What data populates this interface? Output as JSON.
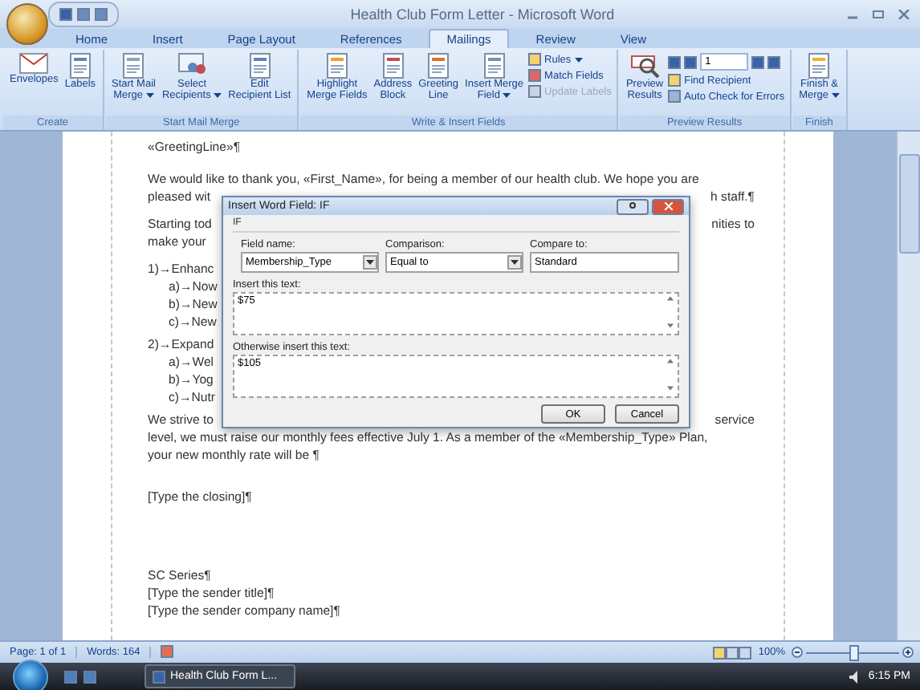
{
  "window": {
    "title": "Health Club Form Letter - Microsoft Word"
  },
  "tabs": [
    {
      "label": "Home",
      "selected": false
    },
    {
      "label": "Insert",
      "selected": false
    },
    {
      "label": "Page Layout",
      "selected": false
    },
    {
      "label": "References",
      "selected": false
    },
    {
      "label": "Mailings",
      "selected": true
    },
    {
      "label": "Review",
      "selected": false
    },
    {
      "label": "View",
      "selected": false
    }
  ],
  "ribbon": [
    {
      "label": "Create",
      "items": [
        {
          "kind": "large",
          "lines": [
            "Envelopes"
          ],
          "dropdown": false
        },
        {
          "kind": "large",
          "lines": [
            "Labels"
          ],
          "dropdown": false
        }
      ]
    },
    {
      "label": "Start Mail Merge",
      "items": [
        {
          "kind": "large",
          "lines": [
            "Start Mail",
            "Merge"
          ],
          "dropdown": true
        },
        {
          "kind": "large",
          "lines": [
            "Select",
            "Recipients"
          ],
          "dropdown": true
        },
        {
          "kind": "large",
          "lines": [
            "Edit",
            "Recipient List"
          ],
          "dropdown": false
        }
      ]
    },
    {
      "label": "Write & Insert Fields",
      "items": [
        {
          "kind": "large",
          "lines": [
            "Highlight",
            "Merge Fields"
          ],
          "dropdown": false
        },
        {
          "kind": "large",
          "lines": [
            "Address",
            "Block"
          ],
          "dropdown": false
        },
        {
          "kind": "large",
          "lines": [
            "Greeting",
            "Line"
          ],
          "dropdown": false
        },
        {
          "kind": "large",
          "lines": [
            "Insert Merge",
            "Field"
          ],
          "dropdown": true
        },
        {
          "kind": "stack",
          "rows": [
            {
              "label": "Rules",
              "dropdown": true,
              "disabled": false
            },
            {
              "label": "Match Fields",
              "dropdown": false,
              "disabled": false
            },
            {
              "label": "Update Labels",
              "dropdown": false,
              "disabled": true
            }
          ]
        }
      ]
    },
    {
      "label": "Preview Results",
      "items": [
        {
          "kind": "large",
          "lines": [
            "Preview",
            "Results"
          ],
          "dropdown": false
        },
        {
          "kind": "nav",
          "value": "1",
          "rows": [
            {
              "label": "Find Recipient",
              "dropdown": false,
              "disabled": false
            },
            {
              "label": "Auto Check for Errors",
              "dropdown": false,
              "disabled": false
            }
          ]
        }
      ]
    },
    {
      "label": "Finish",
      "items": [
        {
          "kind": "large",
          "lines": [
            "Finish &",
            "Merge"
          ],
          "dropdown": true
        }
      ]
    }
  ],
  "document": {
    "paragraphs": [
      {
        "kind": "greeting",
        "lines": [
          {
            "kind": "text",
            "left": "«GreetingLine»¶"
          }
        ]
      },
      {
        "kind": "body",
        "lines": [
          {
            "kind": "text",
            "left": "We would like to thank you, «First_Name», for being a member of our health club. We hope you are"
          },
          {
            "kind": "text",
            "left": "pleased wit",
            "right": "h staff.¶"
          }
        ]
      },
      {
        "kind": "body",
        "lines": [
          {
            "kind": "text",
            "left": "Starting tod",
            "right": "nities to"
          },
          {
            "kind": "text",
            "left": "make your"
          }
        ]
      },
      {
        "kind": "list",
        "lines": [
          {
            "kind": "item",
            "left": "1)→Enhanc"
          },
          {
            "kind": "subitem",
            "left": "a)→Now"
          },
          {
            "kind": "subitem",
            "left": "b)→New"
          },
          {
            "kind": "subitem",
            "left": "c)→New"
          }
        ]
      },
      {
        "kind": "list",
        "lines": [
          {
            "kind": "item",
            "left": "2)→Expand"
          },
          {
            "kind": "subitem",
            "left": "a)→Wel"
          },
          {
            "kind": "subitem",
            "left": "b)→Yog"
          },
          {
            "kind": "subitem",
            "left": "c)→Nutr"
          }
        ]
      },
      {
        "kind": "final",
        "lines": [
          {
            "kind": "text",
            "left": "We strive to",
            "right": "service"
          },
          {
            "kind": "text",
            "left": "level, we must raise our monthly fees effective July 1. As a member of the «Membership_Type» Plan,"
          },
          {
            "kind": "text",
            "left": "your new monthly rate will be ¶"
          }
        ]
      },
      {
        "kind": "closing",
        "lines": [
          {
            "kind": "text",
            "left": "[Type the closing]¶"
          }
        ]
      },
      {
        "kind": "signature",
        "lines": [
          {
            "kind": "text",
            "left": "SC Series¶"
          },
          {
            "kind": "text",
            "left": "[Type the sender title]¶"
          },
          {
            "kind": "text",
            "left": "[Type the sender company name]¶"
          }
        ]
      }
    ]
  },
  "dialog": {
    "title": "Insert Word Field: IF",
    "section": "IF",
    "fields": [
      {
        "kind": "select",
        "label": "Field name:",
        "value": "Membership_Type"
      },
      {
        "kind": "select",
        "label": "Comparison:",
        "value": "Equal to"
      },
      {
        "kind": "text",
        "label": "Compare to:",
        "value": "Standard"
      }
    ],
    "areas": [
      {
        "label": "Insert this text:",
        "value": "$75"
      },
      {
        "label": "Otherwise insert this text:",
        "value": "$105"
      }
    ],
    "buttons": [
      "OK",
      "Cancel"
    ]
  },
  "status_bar": {
    "page": "Page: 1 of 1",
    "words": "Words: 164",
    "zoom": "100%",
    "zoom_level": {
      "level": 0.5
    }
  },
  "taskbar": {
    "task": "Health Club Form L...",
    "time": "6:15 PM"
  }
}
